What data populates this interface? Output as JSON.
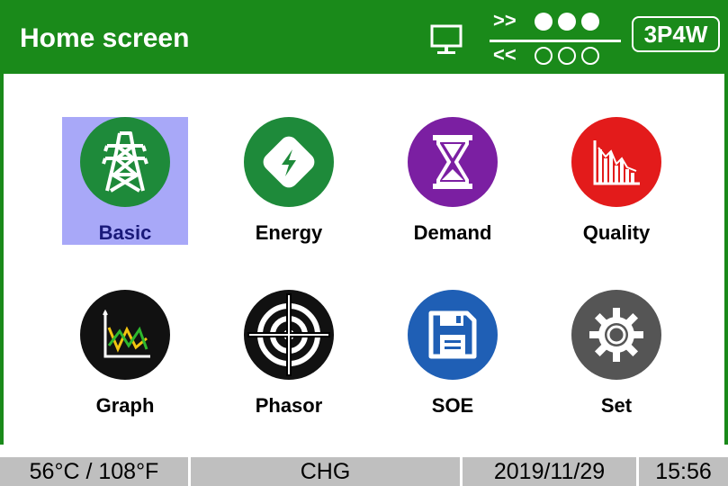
{
  "header": {
    "title": "Home screen",
    "comm_tx_label": ">>",
    "comm_rx_label": "<<",
    "wiring_mode": "3P4W",
    "pc_icon": "pc-monitor-icon"
  },
  "menu": {
    "items": [
      {
        "label": "Basic",
        "icon": "transmission-tower-icon",
        "color": "#1e8a3a",
        "selected": true
      },
      {
        "label": "Energy",
        "icon": "lightning-bolt-icon",
        "color": "#1e8a3a",
        "selected": false
      },
      {
        "label": "Demand",
        "icon": "hourglass-icon",
        "color": "#7b1fa2",
        "selected": false
      },
      {
        "label": "Quality",
        "icon": "bar-chart-icon",
        "color": "#e31b1b",
        "selected": false
      },
      {
        "label": "Graph",
        "icon": "line-graph-icon",
        "color": "#111111",
        "selected": false
      },
      {
        "label": "Phasor",
        "icon": "crosshair-icon",
        "color": "#111111",
        "selected": false
      },
      {
        "label": "SOE",
        "icon": "floppy-disk-icon",
        "color": "#1f5fb5",
        "selected": false
      },
      {
        "label": "Set",
        "icon": "gear-icon",
        "color": "#555555",
        "selected": false
      }
    ]
  },
  "status": {
    "temperature": "56°C / 108°F",
    "mode": "CHG",
    "date": "2019/11/29",
    "time": "15:56"
  },
  "colors": {
    "header_green": "#1a8a1a",
    "selection": "#a8a8f8",
    "status_bar": "#bfbfbf"
  }
}
